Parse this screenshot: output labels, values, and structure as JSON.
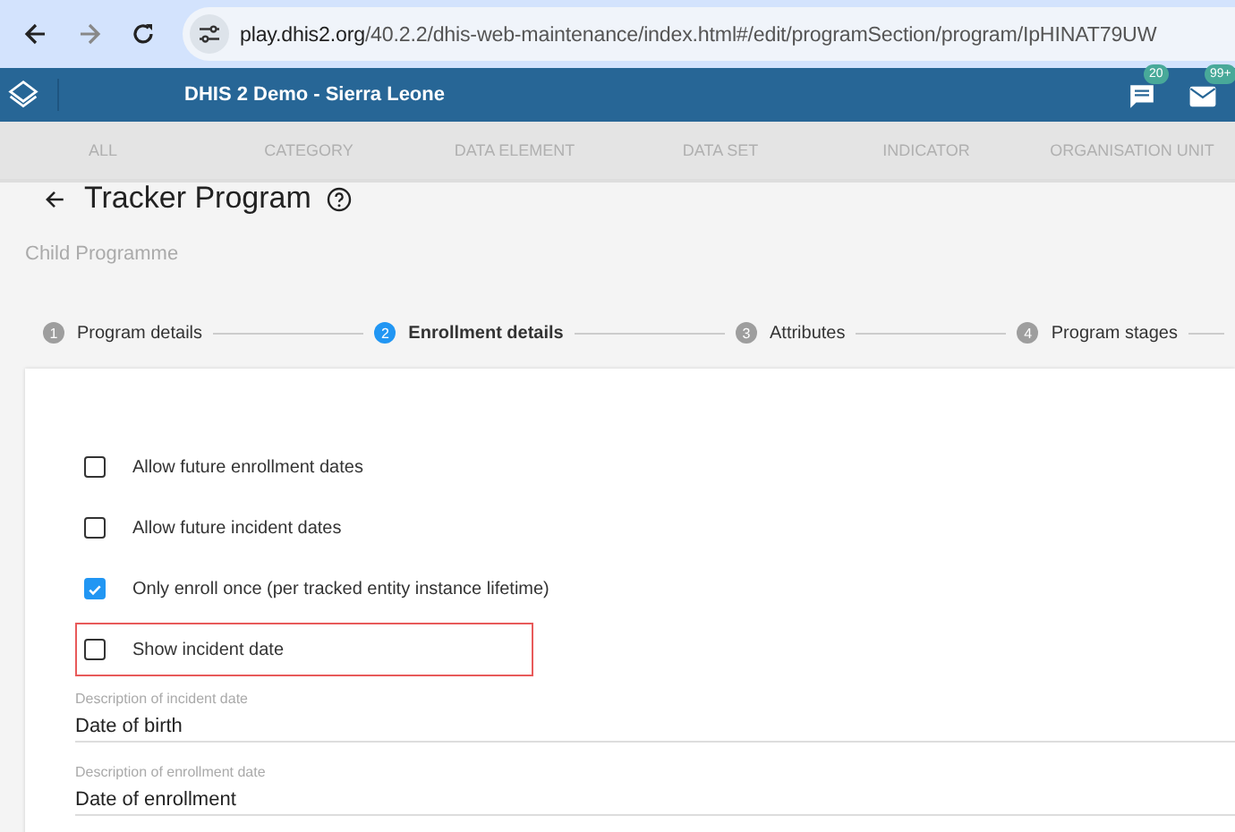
{
  "browser": {
    "url_host": "play.dhis2.org",
    "url_path": "/40.2.2/dhis-web-maintenance/index.html#/edit/programSection/program/IpHINAT79UW"
  },
  "header": {
    "title": "DHIS 2 Demo - Sierra Leone",
    "messages_badge": "20",
    "mail_badge": "99+"
  },
  "tabs": [
    {
      "label": "ALL",
      "selected": false
    },
    {
      "label": "CATEGORY",
      "selected": false
    },
    {
      "label": "DATA ELEMENT",
      "selected": false
    },
    {
      "label": "DATA SET",
      "selected": false
    },
    {
      "label": "INDICATOR",
      "selected": false
    },
    {
      "label": "ORGANISATION UNIT",
      "selected": false
    }
  ],
  "page": {
    "title": "Tracker Program",
    "subtitle": "Child Programme"
  },
  "steps": [
    {
      "number": "1",
      "label": "Program details",
      "selected": false
    },
    {
      "number": "2",
      "label": "Enrollment details",
      "selected": true
    },
    {
      "number": "3",
      "label": "Attributes",
      "selected": false
    },
    {
      "number": "4",
      "label": "Program stages",
      "selected": false
    }
  ],
  "options": [
    {
      "label": "Allow future enrollment dates",
      "checked": false,
      "highlighted": false
    },
    {
      "label": "Allow future incident dates",
      "checked": false,
      "highlighted": false
    },
    {
      "label": "Only enroll once (per tracked entity instance lifetime)",
      "checked": true,
      "highlighted": false
    },
    {
      "label": "Show incident date",
      "checked": false,
      "highlighted": true
    }
  ],
  "fields": [
    {
      "label": "Description of incident date",
      "value": "Date of birth"
    },
    {
      "label": "Description of enrollment date",
      "value": "Date of enrollment"
    }
  ]
}
